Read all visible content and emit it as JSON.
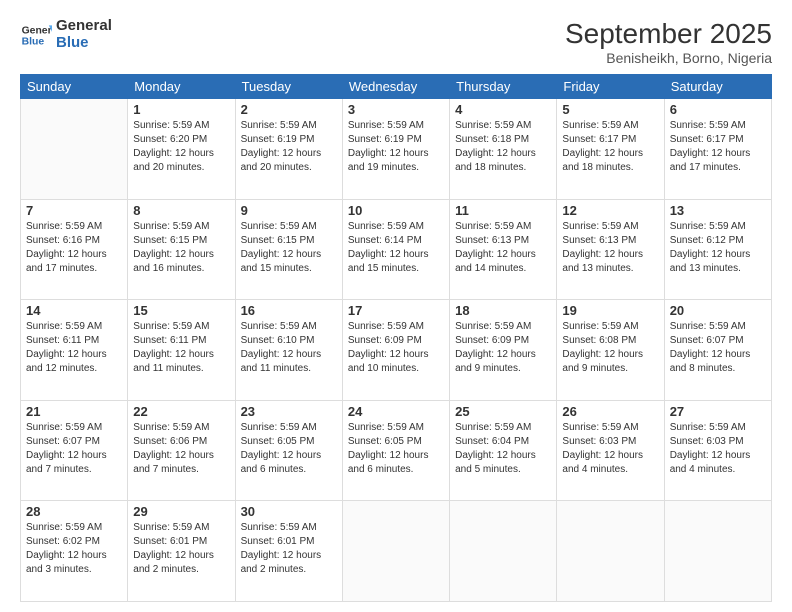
{
  "header": {
    "logo_line1": "General",
    "logo_line2": "Blue",
    "month": "September 2025",
    "location": "Benisheikh, Borno, Nigeria"
  },
  "weekdays": [
    "Sunday",
    "Monday",
    "Tuesday",
    "Wednesday",
    "Thursday",
    "Friday",
    "Saturday"
  ],
  "weeks": [
    [
      {
        "day": "",
        "info": ""
      },
      {
        "day": "1",
        "info": "Sunrise: 5:59 AM\nSunset: 6:20 PM\nDaylight: 12 hours\nand 20 minutes."
      },
      {
        "day": "2",
        "info": "Sunrise: 5:59 AM\nSunset: 6:19 PM\nDaylight: 12 hours\nand 20 minutes."
      },
      {
        "day": "3",
        "info": "Sunrise: 5:59 AM\nSunset: 6:19 PM\nDaylight: 12 hours\nand 19 minutes."
      },
      {
        "day": "4",
        "info": "Sunrise: 5:59 AM\nSunset: 6:18 PM\nDaylight: 12 hours\nand 18 minutes."
      },
      {
        "day": "5",
        "info": "Sunrise: 5:59 AM\nSunset: 6:17 PM\nDaylight: 12 hours\nand 18 minutes."
      },
      {
        "day": "6",
        "info": "Sunrise: 5:59 AM\nSunset: 6:17 PM\nDaylight: 12 hours\nand 17 minutes."
      }
    ],
    [
      {
        "day": "7",
        "info": "Sunrise: 5:59 AM\nSunset: 6:16 PM\nDaylight: 12 hours\nand 17 minutes."
      },
      {
        "day": "8",
        "info": "Sunrise: 5:59 AM\nSunset: 6:15 PM\nDaylight: 12 hours\nand 16 minutes."
      },
      {
        "day": "9",
        "info": "Sunrise: 5:59 AM\nSunset: 6:15 PM\nDaylight: 12 hours\nand 15 minutes."
      },
      {
        "day": "10",
        "info": "Sunrise: 5:59 AM\nSunset: 6:14 PM\nDaylight: 12 hours\nand 15 minutes."
      },
      {
        "day": "11",
        "info": "Sunrise: 5:59 AM\nSunset: 6:13 PM\nDaylight: 12 hours\nand 14 minutes."
      },
      {
        "day": "12",
        "info": "Sunrise: 5:59 AM\nSunset: 6:13 PM\nDaylight: 12 hours\nand 13 minutes."
      },
      {
        "day": "13",
        "info": "Sunrise: 5:59 AM\nSunset: 6:12 PM\nDaylight: 12 hours\nand 13 minutes."
      }
    ],
    [
      {
        "day": "14",
        "info": "Sunrise: 5:59 AM\nSunset: 6:11 PM\nDaylight: 12 hours\nand 12 minutes."
      },
      {
        "day": "15",
        "info": "Sunrise: 5:59 AM\nSunset: 6:11 PM\nDaylight: 12 hours\nand 11 minutes."
      },
      {
        "day": "16",
        "info": "Sunrise: 5:59 AM\nSunset: 6:10 PM\nDaylight: 12 hours\nand 11 minutes."
      },
      {
        "day": "17",
        "info": "Sunrise: 5:59 AM\nSunset: 6:09 PM\nDaylight: 12 hours\nand 10 minutes."
      },
      {
        "day": "18",
        "info": "Sunrise: 5:59 AM\nSunset: 6:09 PM\nDaylight: 12 hours\nand 9 minutes."
      },
      {
        "day": "19",
        "info": "Sunrise: 5:59 AM\nSunset: 6:08 PM\nDaylight: 12 hours\nand 9 minutes."
      },
      {
        "day": "20",
        "info": "Sunrise: 5:59 AM\nSunset: 6:07 PM\nDaylight: 12 hours\nand 8 minutes."
      }
    ],
    [
      {
        "day": "21",
        "info": "Sunrise: 5:59 AM\nSunset: 6:07 PM\nDaylight: 12 hours\nand 7 minutes."
      },
      {
        "day": "22",
        "info": "Sunrise: 5:59 AM\nSunset: 6:06 PM\nDaylight: 12 hours\nand 7 minutes."
      },
      {
        "day": "23",
        "info": "Sunrise: 5:59 AM\nSunset: 6:05 PM\nDaylight: 12 hours\nand 6 minutes."
      },
      {
        "day": "24",
        "info": "Sunrise: 5:59 AM\nSunset: 6:05 PM\nDaylight: 12 hours\nand 6 minutes."
      },
      {
        "day": "25",
        "info": "Sunrise: 5:59 AM\nSunset: 6:04 PM\nDaylight: 12 hours\nand 5 minutes."
      },
      {
        "day": "26",
        "info": "Sunrise: 5:59 AM\nSunset: 6:03 PM\nDaylight: 12 hours\nand 4 minutes."
      },
      {
        "day": "27",
        "info": "Sunrise: 5:59 AM\nSunset: 6:03 PM\nDaylight: 12 hours\nand 4 minutes."
      }
    ],
    [
      {
        "day": "28",
        "info": "Sunrise: 5:59 AM\nSunset: 6:02 PM\nDaylight: 12 hours\nand 3 minutes."
      },
      {
        "day": "29",
        "info": "Sunrise: 5:59 AM\nSunset: 6:01 PM\nDaylight: 12 hours\nand 2 minutes."
      },
      {
        "day": "30",
        "info": "Sunrise: 5:59 AM\nSunset: 6:01 PM\nDaylight: 12 hours\nand 2 minutes."
      },
      {
        "day": "",
        "info": ""
      },
      {
        "day": "",
        "info": ""
      },
      {
        "day": "",
        "info": ""
      },
      {
        "day": "",
        "info": ""
      }
    ]
  ]
}
